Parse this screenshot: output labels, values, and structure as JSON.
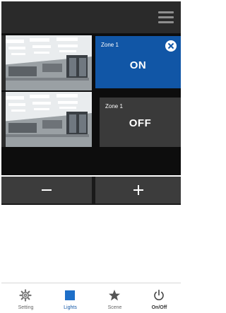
{
  "header": {
    "menu_icon": "hamburger-menu-icon"
  },
  "zones": [
    {
      "name": "Zone 1",
      "state": "ON",
      "selected": true
    },
    {
      "name": "Zone 1",
      "state": "OFF",
      "selected": false
    }
  ],
  "dimmer": {
    "decrease_icon": "minus-icon",
    "increase_icon": "plus-icon"
  },
  "tabs": [
    {
      "label": "Setting",
      "icon": "gear-icon",
      "active": false
    },
    {
      "label": "Lights",
      "icon": "square-icon",
      "active": true
    },
    {
      "label": "Scene",
      "icon": "star-icon",
      "active": false
    },
    {
      "label": "On/Off",
      "icon": "power-icon",
      "active": false
    }
  ],
  "colors": {
    "accent": "#1156a6",
    "tile_off": "#3a3a3a",
    "background_dark": "#0d0d0d"
  }
}
